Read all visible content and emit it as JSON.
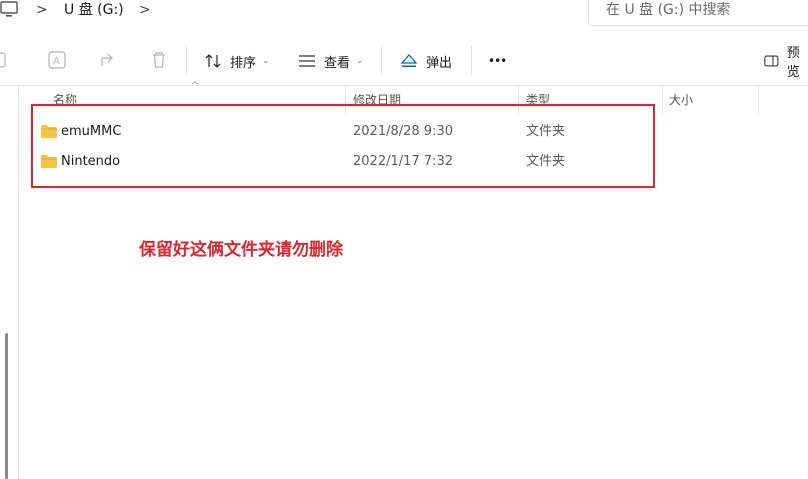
{
  "address_bar": {
    "separator": ">",
    "drive": "U 盘 (G:)",
    "search_placeholder": "在 U 盘 (G:) 中搜索"
  },
  "toolbar": {
    "sort_label": "排序",
    "view_label": "查看",
    "eject_label": "弹出",
    "more_label": "•••",
    "preview_label": "预览"
  },
  "columns": {
    "name": "名称",
    "date": "修改日期",
    "type": "类型",
    "size": "大小"
  },
  "files": [
    {
      "name": "emuMMC",
      "date": "2021/8/28 9:30",
      "type": "文件夹"
    },
    {
      "name": "Nintendo",
      "date": "2022/1/17 7:32",
      "type": "文件夹"
    }
  ],
  "annotation": {
    "text": "保留好这俩文件夹请勿删除",
    "color": "#e0262c"
  },
  "colors": {
    "folder": "#f4c542",
    "accent": "#0067c0"
  }
}
